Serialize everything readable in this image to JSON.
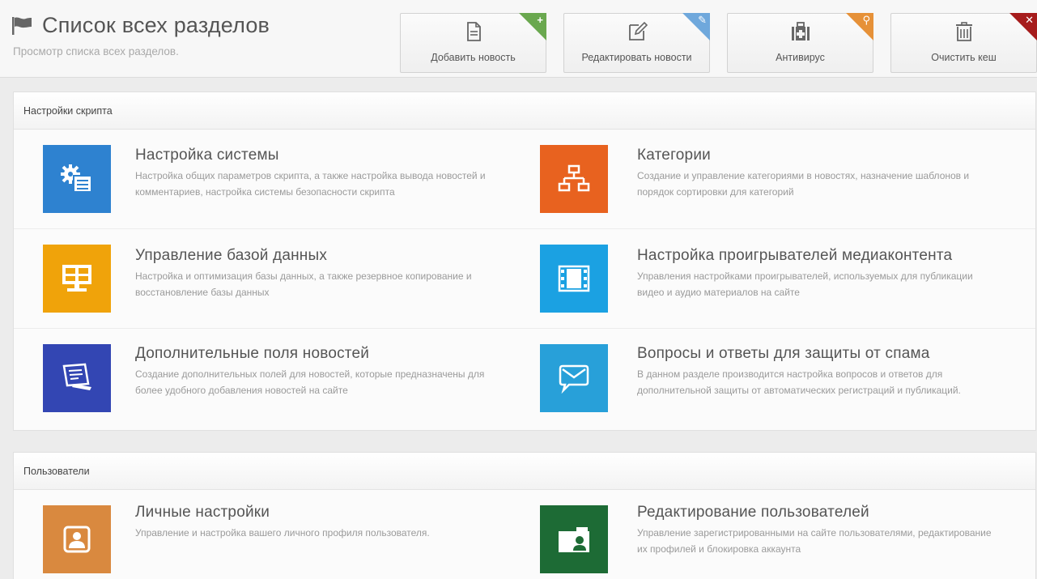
{
  "header": {
    "title": "Список всех разделов",
    "subtitle": "Просмотр списка всех разделов."
  },
  "actions": [
    {
      "label": "Добавить новость",
      "icon": "document-icon",
      "corner": "+",
      "corner_color": "#6aa84f"
    },
    {
      "label": "Редактировать новости",
      "icon": "edit-icon",
      "corner": "✎",
      "corner_color": "#6fa8dc"
    },
    {
      "label": "Антивирус",
      "icon": "medkit-icon",
      "corner": "⚲",
      "corner_color": "#e69138"
    },
    {
      "label": "Очистить кеш",
      "icon": "trash-icon",
      "corner": "✕",
      "corner_color": "#a61c1c"
    }
  ],
  "sections": [
    {
      "title": "Настройки скрипта",
      "rows": [
        [
          {
            "title": "Настройка системы",
            "desc": "Настройка общих параметров скрипта, а также настройка вывода новостей и комментариев, настройка системы безопасности скрипта",
            "icon": "settings-icon",
            "color": "#2e82d0"
          },
          {
            "title": "Категории",
            "desc": "Создание и управление категориями в новостях, назначение шаблонов и порядок сортировки для категорий",
            "icon": "sitemap-icon",
            "color": "#e8621f"
          }
        ],
        [
          {
            "title": "Управление базой данных",
            "desc": "Настройка и оптимизация базы данных, а также резервное копирование и восстановление базы данных",
            "icon": "database-monitor-icon",
            "color": "#f0a30a"
          },
          {
            "title": "Настройка проигрывателей медиаконтента",
            "desc": "Управления настройками проигрывателей, используемых для публикации видео и аудио материалов на сайте",
            "icon": "film-icon",
            "color": "#1ba1e2"
          }
        ],
        [
          {
            "title": "Дополнительные поля новостей",
            "desc": "Создание дополнительных полей для новостей, которые предназначены для более удобного добавления новостей на сайте",
            "icon": "form-icon",
            "color": "#3346b3"
          },
          {
            "title": "Вопросы и ответы для защиты от спама",
            "desc": "В данном разделе производится настройка вопросов и ответов для дополнительной защиты от автоматических регистраций и публикаций.",
            "icon": "envelope-icon",
            "color": "#28a0d9"
          }
        ]
      ]
    },
    {
      "title": "Пользователи",
      "rows": [
        [
          {
            "title": "Личные настройки",
            "desc": "Управление и настройка вашего личного профиля пользователя.",
            "icon": "user-icon",
            "color": "#d9893f"
          },
          {
            "title": "Редактирование пользователей",
            "desc": "Управление зарегистрированными на сайте пользователями, редактирование их профилей и блокировка аккаунта",
            "icon": "id-card-icon",
            "color": "#1d6b35"
          }
        ]
      ]
    }
  ]
}
